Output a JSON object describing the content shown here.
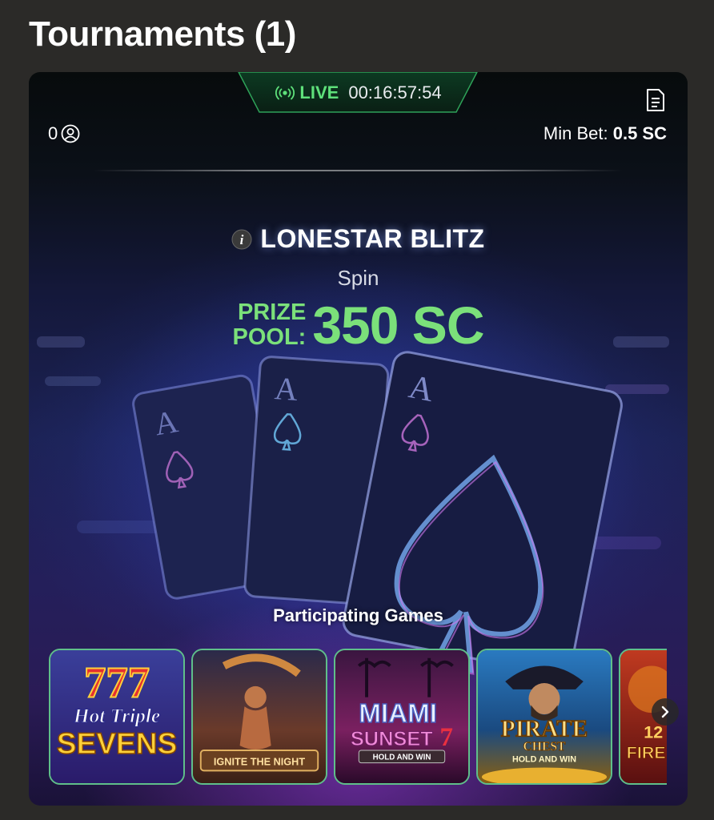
{
  "page": {
    "heading": "Tournaments (1)"
  },
  "tournament": {
    "status": "LIVE",
    "time_left": "00:16:57:54",
    "players": "0",
    "min_bet_label": "Min Bet:",
    "min_bet_value": "0.5 SC",
    "name": "LONESTAR BLITZ",
    "mode": "Spin",
    "prize_label_line1": "PRIZE",
    "prize_label_line2": "POOL:",
    "prize_value": "350 SC"
  },
  "games": {
    "label": "Participating Games",
    "tiles": [
      {
        "name": "Hot Triple Sevens",
        "line1": "Hot Triple",
        "line2": "SEVENS"
      },
      {
        "name": "Ignite the Night",
        "line1": "IGNITE THE NIGHT"
      },
      {
        "name": "Miami Sunset 7s",
        "line1": "MIAMI",
        "line2": "SUNSET",
        "line3": "HOLD AND WIN"
      },
      {
        "name": "Pirate Chest",
        "line1": "PIRATE",
        "line2": "CHEST",
        "line3": "HOLD AND WIN"
      },
      {
        "name": "Fire",
        "line1": "12",
        "line2": "FIRE"
      }
    ]
  },
  "colors": {
    "accent_green": "#7be07a",
    "live_green": "#5ee07a",
    "background": "#2b2a28"
  },
  "icons": [
    "broadcast-icon",
    "document-icon",
    "user-icon",
    "info-icon",
    "chevron-right-icon"
  ]
}
